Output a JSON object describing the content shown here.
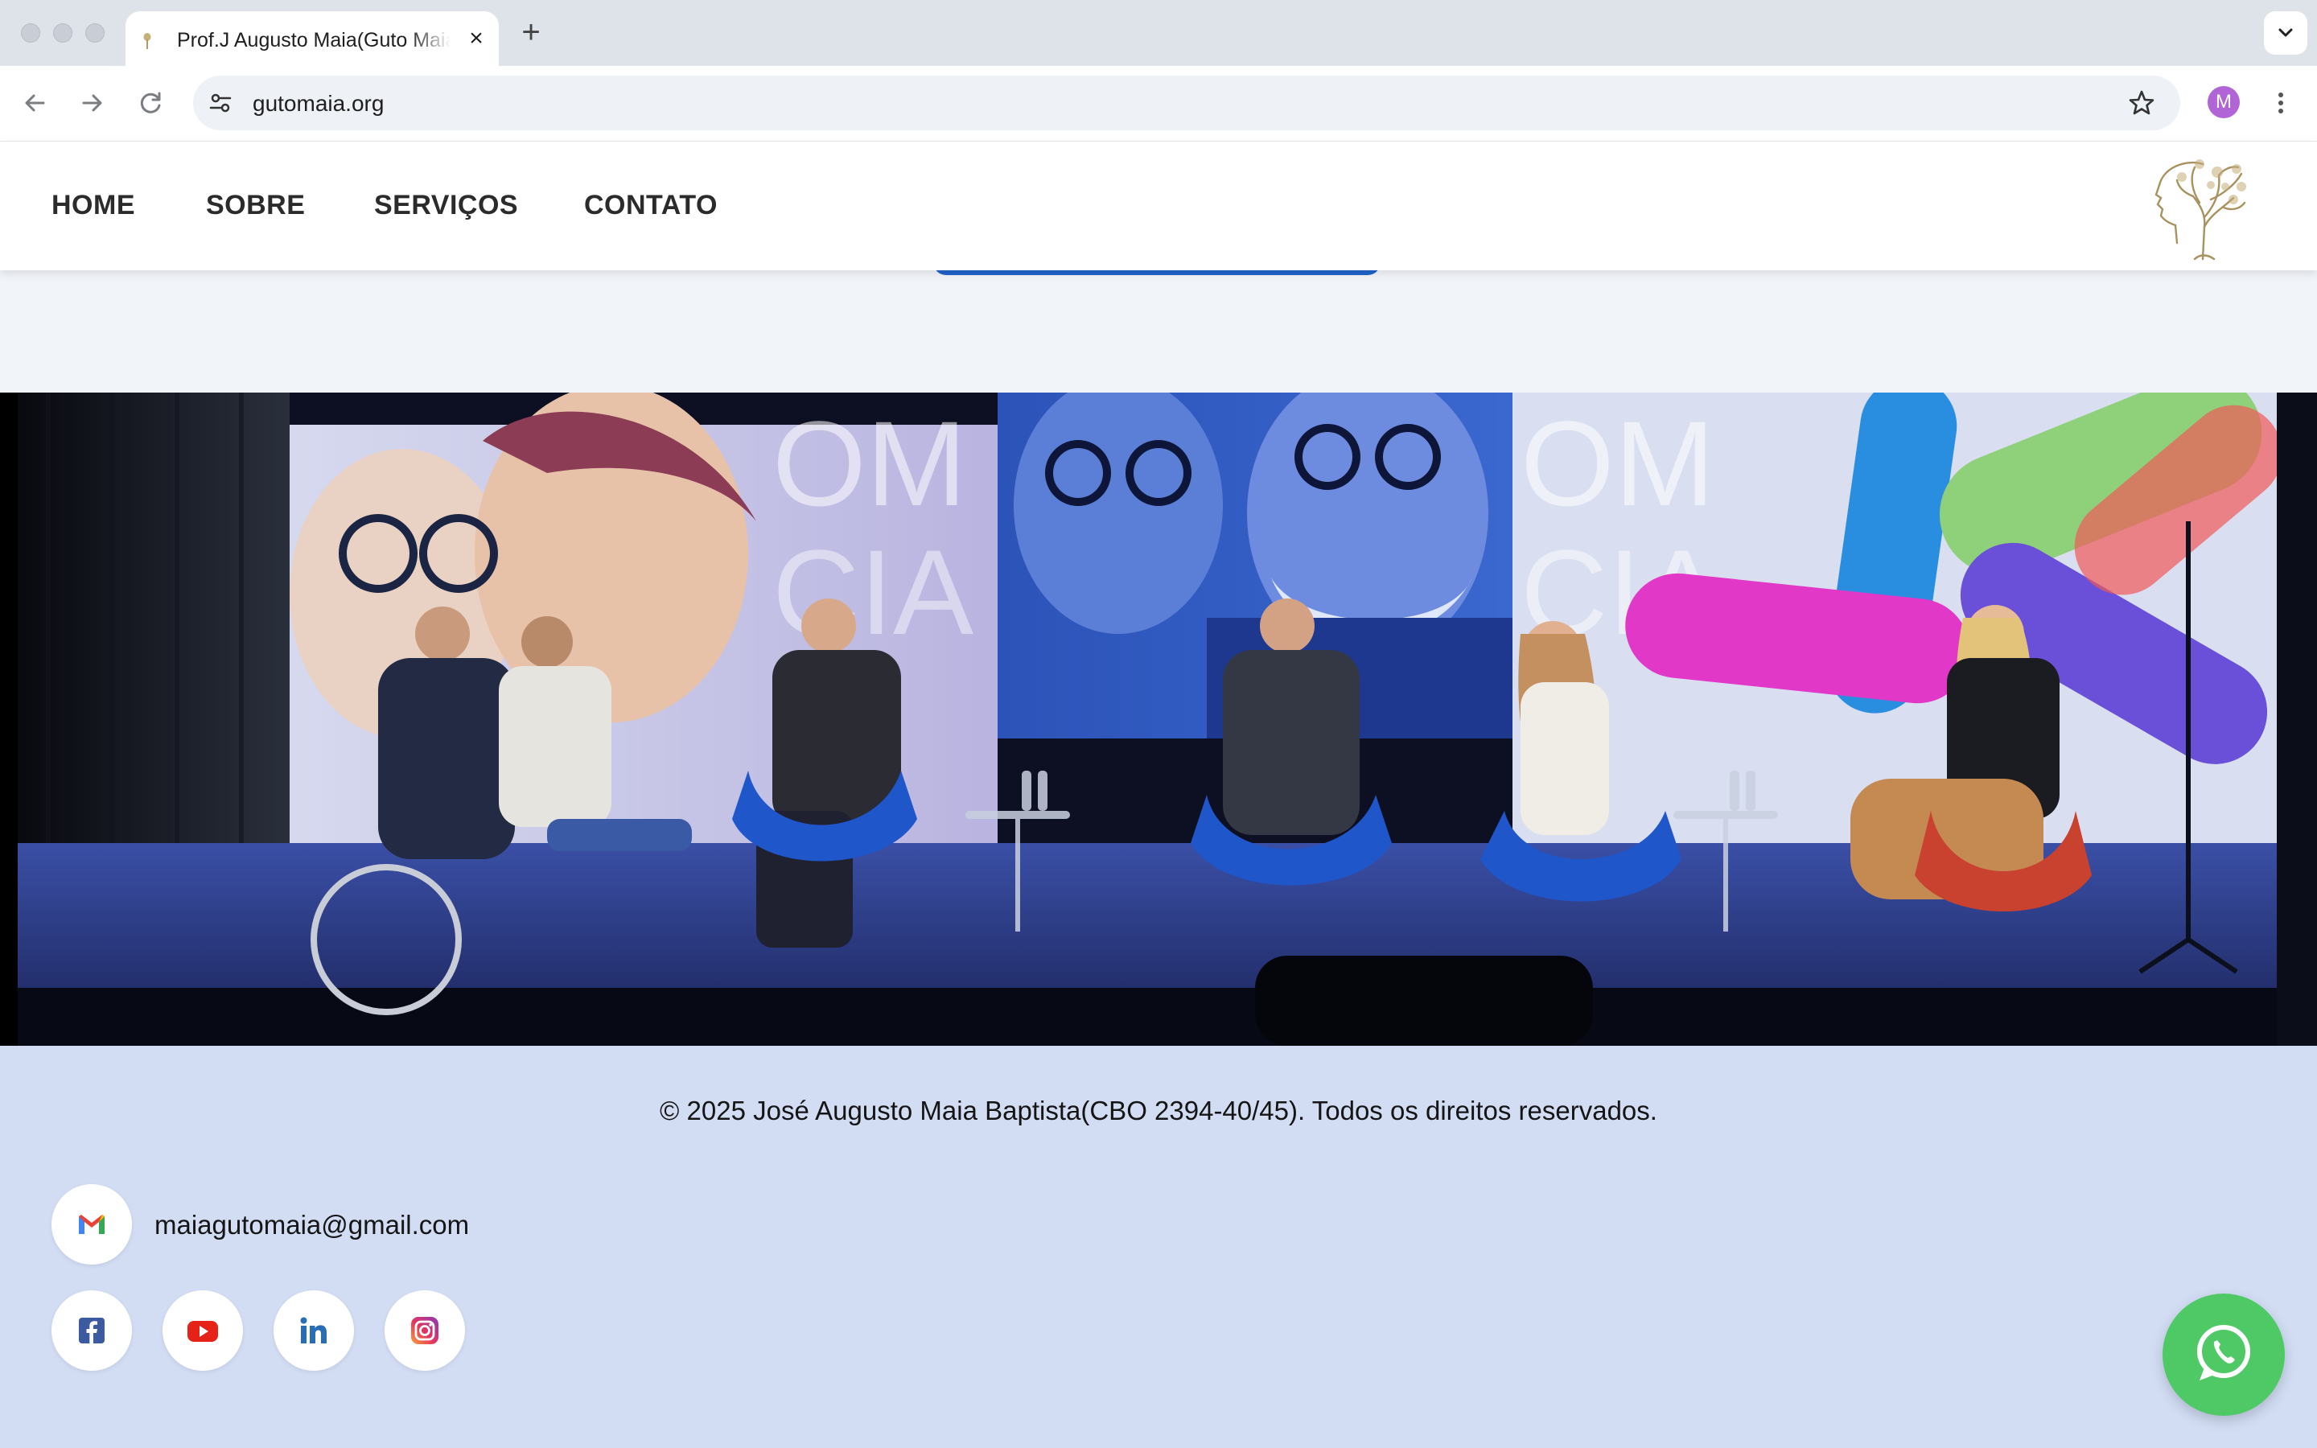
{
  "browser": {
    "tab_title": "Prof.J Augusto Maia(Guto Maia)",
    "url": "gutomaia.org",
    "profile_initial": "M"
  },
  "site": {
    "nav": [
      "HOME",
      "SOBRE",
      "SERVIÇOS",
      "CONTATO"
    ],
    "footer": {
      "copyright": "© 2025 José Augusto Maia Baptista(CBO 2394-40/45). Todos os direitos reservados.",
      "email": "maiagutomaia@gmail.com",
      "social": [
        "facebook-icon",
        "youtube-icon",
        "linkedin-icon",
        "instagram-icon"
      ]
    },
    "colors": {
      "nav_text": "#2b2b2b",
      "footer_bg": "#d2ddf4",
      "accent_blue": "#1f63c9",
      "whatsapp_green": "#4ec966"
    }
  }
}
